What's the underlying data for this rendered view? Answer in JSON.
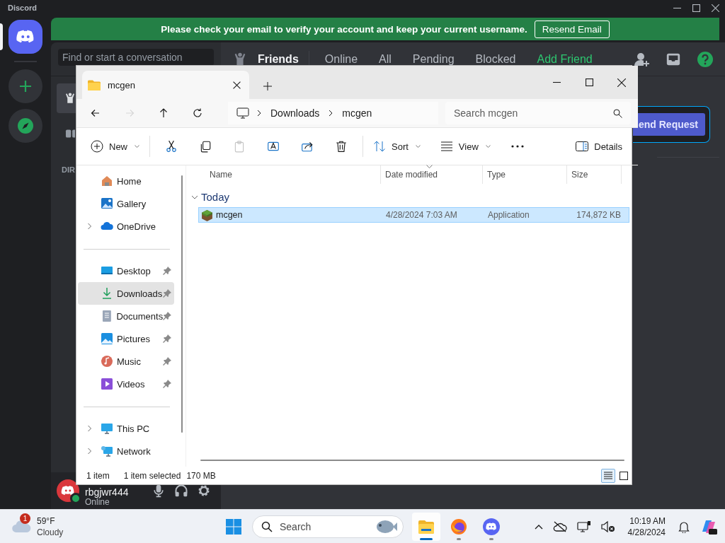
{
  "discord": {
    "app_title": "Discord",
    "banner": {
      "text": "Please check your email to verify your account and keep your current username.",
      "button": "Resend Email"
    },
    "search": {
      "placeholder": "Find or start a conversation"
    },
    "section_label": "DIR",
    "header": {
      "title": "Friends",
      "tabs": [
        {
          "label": "Online",
          "kind": "tab",
          "selected": false
        },
        {
          "label": "All",
          "kind": "tab",
          "selected": false
        },
        {
          "label": "Pending",
          "kind": "tab",
          "selected": false
        },
        {
          "label": "Blocked",
          "kind": "tab",
          "selected": false
        },
        {
          "label": "Add Friend",
          "kind": "add",
          "selected": true
        }
      ]
    },
    "send_button": "end Request",
    "user": {
      "name": "rbgjwr444",
      "status": "Online"
    }
  },
  "explorer": {
    "tab_title": "mcgen",
    "breadcrumb": [
      "Downloads",
      "mcgen"
    ],
    "search": {
      "placeholder": "Search mcgen"
    },
    "nav_buttons": [
      {
        "kind": "back",
        "disabled": false
      },
      {
        "kind": "forward",
        "disabled": true
      },
      {
        "kind": "up",
        "disabled": false
      },
      {
        "kind": "refresh",
        "disabled": false
      }
    ],
    "toolbar": [
      {
        "kind": "new",
        "label": "New"
      },
      {
        "kind": "cut",
        "disabled": false
      },
      {
        "kind": "copy",
        "disabled": false
      },
      {
        "kind": "paste",
        "disabled": true
      },
      {
        "kind": "rename",
        "disabled": false
      },
      {
        "kind": "share",
        "disabled": false
      },
      {
        "kind": "delete",
        "disabled": false
      },
      {
        "kind": "sort",
        "label": "Sort"
      },
      {
        "kind": "view",
        "label": "View"
      },
      {
        "kind": "more"
      },
      {
        "kind": "details",
        "label": "Details"
      }
    ],
    "sidebar": [
      [
        {
          "label": "Home",
          "kind": "home",
          "expandable": false,
          "pinned": false,
          "selected": false
        },
        {
          "label": "Gallery",
          "kind": "gallery",
          "expandable": false,
          "pinned": false,
          "selected": false
        },
        {
          "label": "OneDrive",
          "kind": "cloud",
          "expandable": true,
          "pinned": false,
          "selected": false
        }
      ],
      [
        {
          "label": "Desktop",
          "kind": "desktop",
          "expandable": false,
          "pinned": true,
          "selected": false
        },
        {
          "label": "Downloads",
          "kind": "download",
          "expandable": false,
          "pinned": true,
          "selected": true
        },
        {
          "label": "Documents",
          "kind": "document",
          "expandable": false,
          "pinned": true,
          "selected": false
        },
        {
          "label": "Pictures",
          "kind": "pictures",
          "expandable": false,
          "pinned": true,
          "selected": false
        },
        {
          "label": "Music",
          "kind": "music",
          "expandable": false,
          "pinned": true,
          "selected": false
        },
        {
          "label": "Videos",
          "kind": "videos",
          "expandable": false,
          "pinned": true,
          "selected": false
        }
      ],
      [
        {
          "label": "This PC",
          "kind": "pc",
          "expandable": true,
          "pinned": false,
          "selected": false
        },
        {
          "label": "Network",
          "kind": "network",
          "expandable": true,
          "pinned": false,
          "selected": false
        }
      ]
    ],
    "columns": [
      "Name",
      "Date modified",
      "Type",
      "Size"
    ],
    "groups": [
      {
        "label": "Today",
        "expanded": true,
        "rows": [
          {
            "name": "mcgen",
            "date_modified": "4/28/2024 7:03 AM",
            "type": "Application",
            "size": "174,872 KB",
            "selected": true
          }
        ]
      }
    ],
    "status": {
      "item_count": "1 item",
      "selection": "1 item selected",
      "selection_size": "170 MB"
    },
    "view_modes": [
      {
        "kind": "details",
        "selected": true
      },
      {
        "kind": "tiles",
        "selected": false
      }
    ]
  },
  "taskbar": {
    "weather": {
      "badge": "1",
      "temperature": "59°F",
      "condition": "Cloudy"
    },
    "search": {
      "placeholder": "Search"
    },
    "apps": [
      {
        "kind": "explorer",
        "active": true
      },
      {
        "kind": "firefox",
        "active": false
      },
      {
        "kind": "discord",
        "active": false
      }
    ],
    "clock": {
      "time": "10:19 AM",
      "date": "4/28/2024"
    }
  }
}
